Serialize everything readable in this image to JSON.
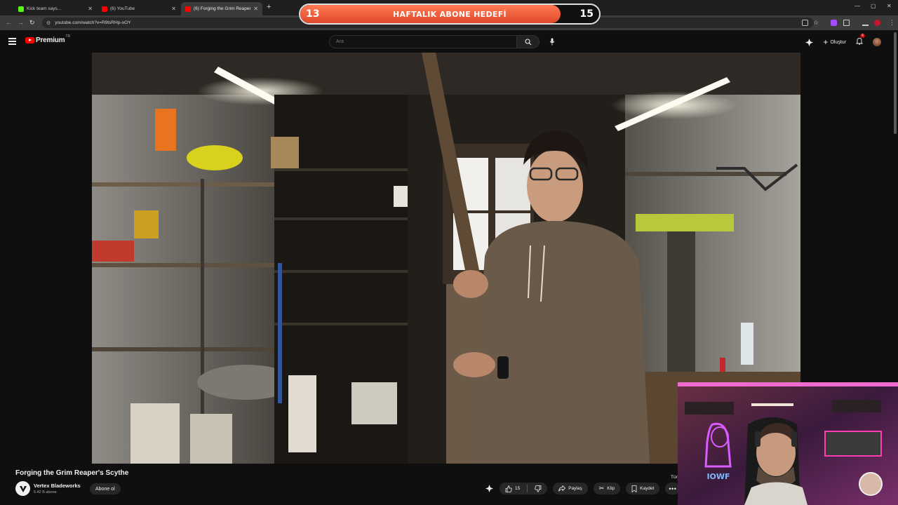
{
  "browser": {
    "tabs": [
      {
        "title": "Kick team says..."
      },
      {
        "title": "(6) YouTube"
      },
      {
        "title": "(6) Forging the Grim Reaper's Sc"
      }
    ],
    "url": "youtube.com/watch?v=R9tsRHp-oOY"
  },
  "goal": {
    "current": "13",
    "target": "15",
    "label": "HAFTALIK ABONE HEDEFİ",
    "progress_fraction": 0.87
  },
  "header": {
    "logo_text": "Premium",
    "country_code": "TR",
    "search_placeholder": "Ara",
    "create_label": "Oluştur",
    "notification_count": "6"
  },
  "video": {
    "title": "Forging the Grim Reaper's Scythe",
    "channel": "Vertex Bladeworks",
    "subscribers": "5.42 B abone",
    "subscribe_label": "Abone ol",
    "like_count": "15",
    "share_label": "Paylaş",
    "clip_label": "Klip",
    "save_label": "Kaydet",
    "language_partial": "Tür"
  },
  "webcam": {
    "neon_text": "IOWF"
  },
  "colors": {
    "accent": "#ff0000",
    "goal_fill": "#e0492a",
    "background": "#0f0f0f"
  }
}
